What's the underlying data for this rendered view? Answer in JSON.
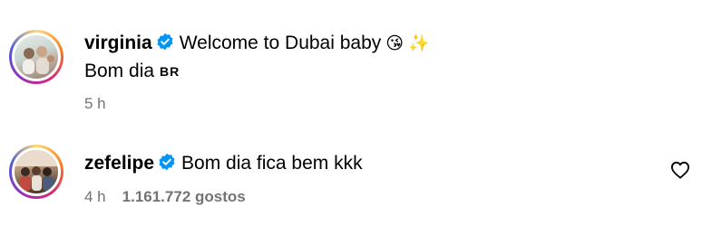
{
  "comments": [
    {
      "username": "virginia",
      "verified": true,
      "text": "Welcome to Dubai baby",
      "emojis": [
        "😘",
        "✨"
      ],
      "second_line": "Bom dia",
      "flag": "BR",
      "time": "5 h"
    },
    {
      "username": "zefelipe",
      "verified": true,
      "text": "Bom dia fica bem kkk",
      "time": "4 h",
      "likes": "1.161.772 gostos"
    }
  ],
  "icons": {
    "verified": "verified-badge-icon",
    "like": "heart-outline-icon"
  },
  "colors": {
    "verified_blue": "#0095f6",
    "meta_gray": "#737373"
  }
}
